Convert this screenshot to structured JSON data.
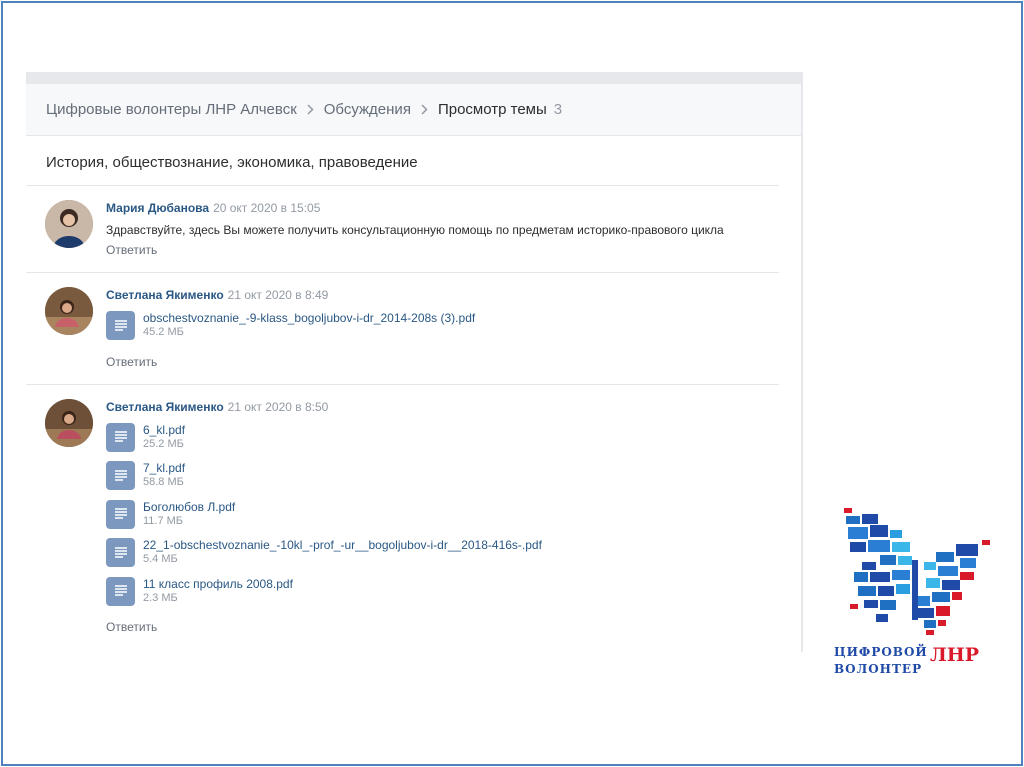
{
  "breadcrumb": {
    "items": [
      "Цифровые волонтеры ЛНР Алчевск",
      "Обсуждения",
      "Просмотр темы"
    ],
    "count": "3"
  },
  "topic": {
    "title": "История, обществознание, экономика, правоведение"
  },
  "posts": [
    {
      "author": "Мария Дюбанова",
      "date": "20 окт 2020 в 15:05",
      "text": "Здравствуйте, здесь Вы можете получить консультационную помощь по предметам историко-правового цикла",
      "reply_label": "Ответить"
    },
    {
      "author": "Светлана Якименко",
      "date": "21 окт 2020 в 8:49",
      "files": [
        {
          "name": "obschestvoznanie_-9-klass_bogoljubov-i-dr_2014-208s (3).pdf",
          "size": "45.2 МБ"
        }
      ],
      "reply_label": "Ответить"
    },
    {
      "author": "Светлана Якименко",
      "date": "21 окт 2020 в 8:50",
      "files": [
        {
          "name": "6_kl.pdf",
          "size": "25.2 МБ"
        },
        {
          "name": "7_kl.pdf",
          "size": "58.8 МБ"
        },
        {
          "name": "Боголюбов Л.pdf",
          "size": "11.7 МБ"
        },
        {
          "name": "22_1-obschestvoznanie_-10kl_-prof_-ur__bogoljubov-i-dr__2018-416s-.pdf",
          "size": "5.4 МБ"
        },
        {
          "name": "11 класс профиль 2008.pdf",
          "size": "2.3 МБ"
        }
      ],
      "reply_label": "Ответить"
    }
  ],
  "logo": {
    "line1": "ЦИФРОВОЙ",
    "line2": "ВОЛОНТЕР",
    "line3": "ЛНР"
  },
  "colors": {
    "link": "#2a5885",
    "file_icon": "#7d98bf",
    "logo_blue": "#1f4aa8",
    "logo_red": "#d81a2a"
  }
}
